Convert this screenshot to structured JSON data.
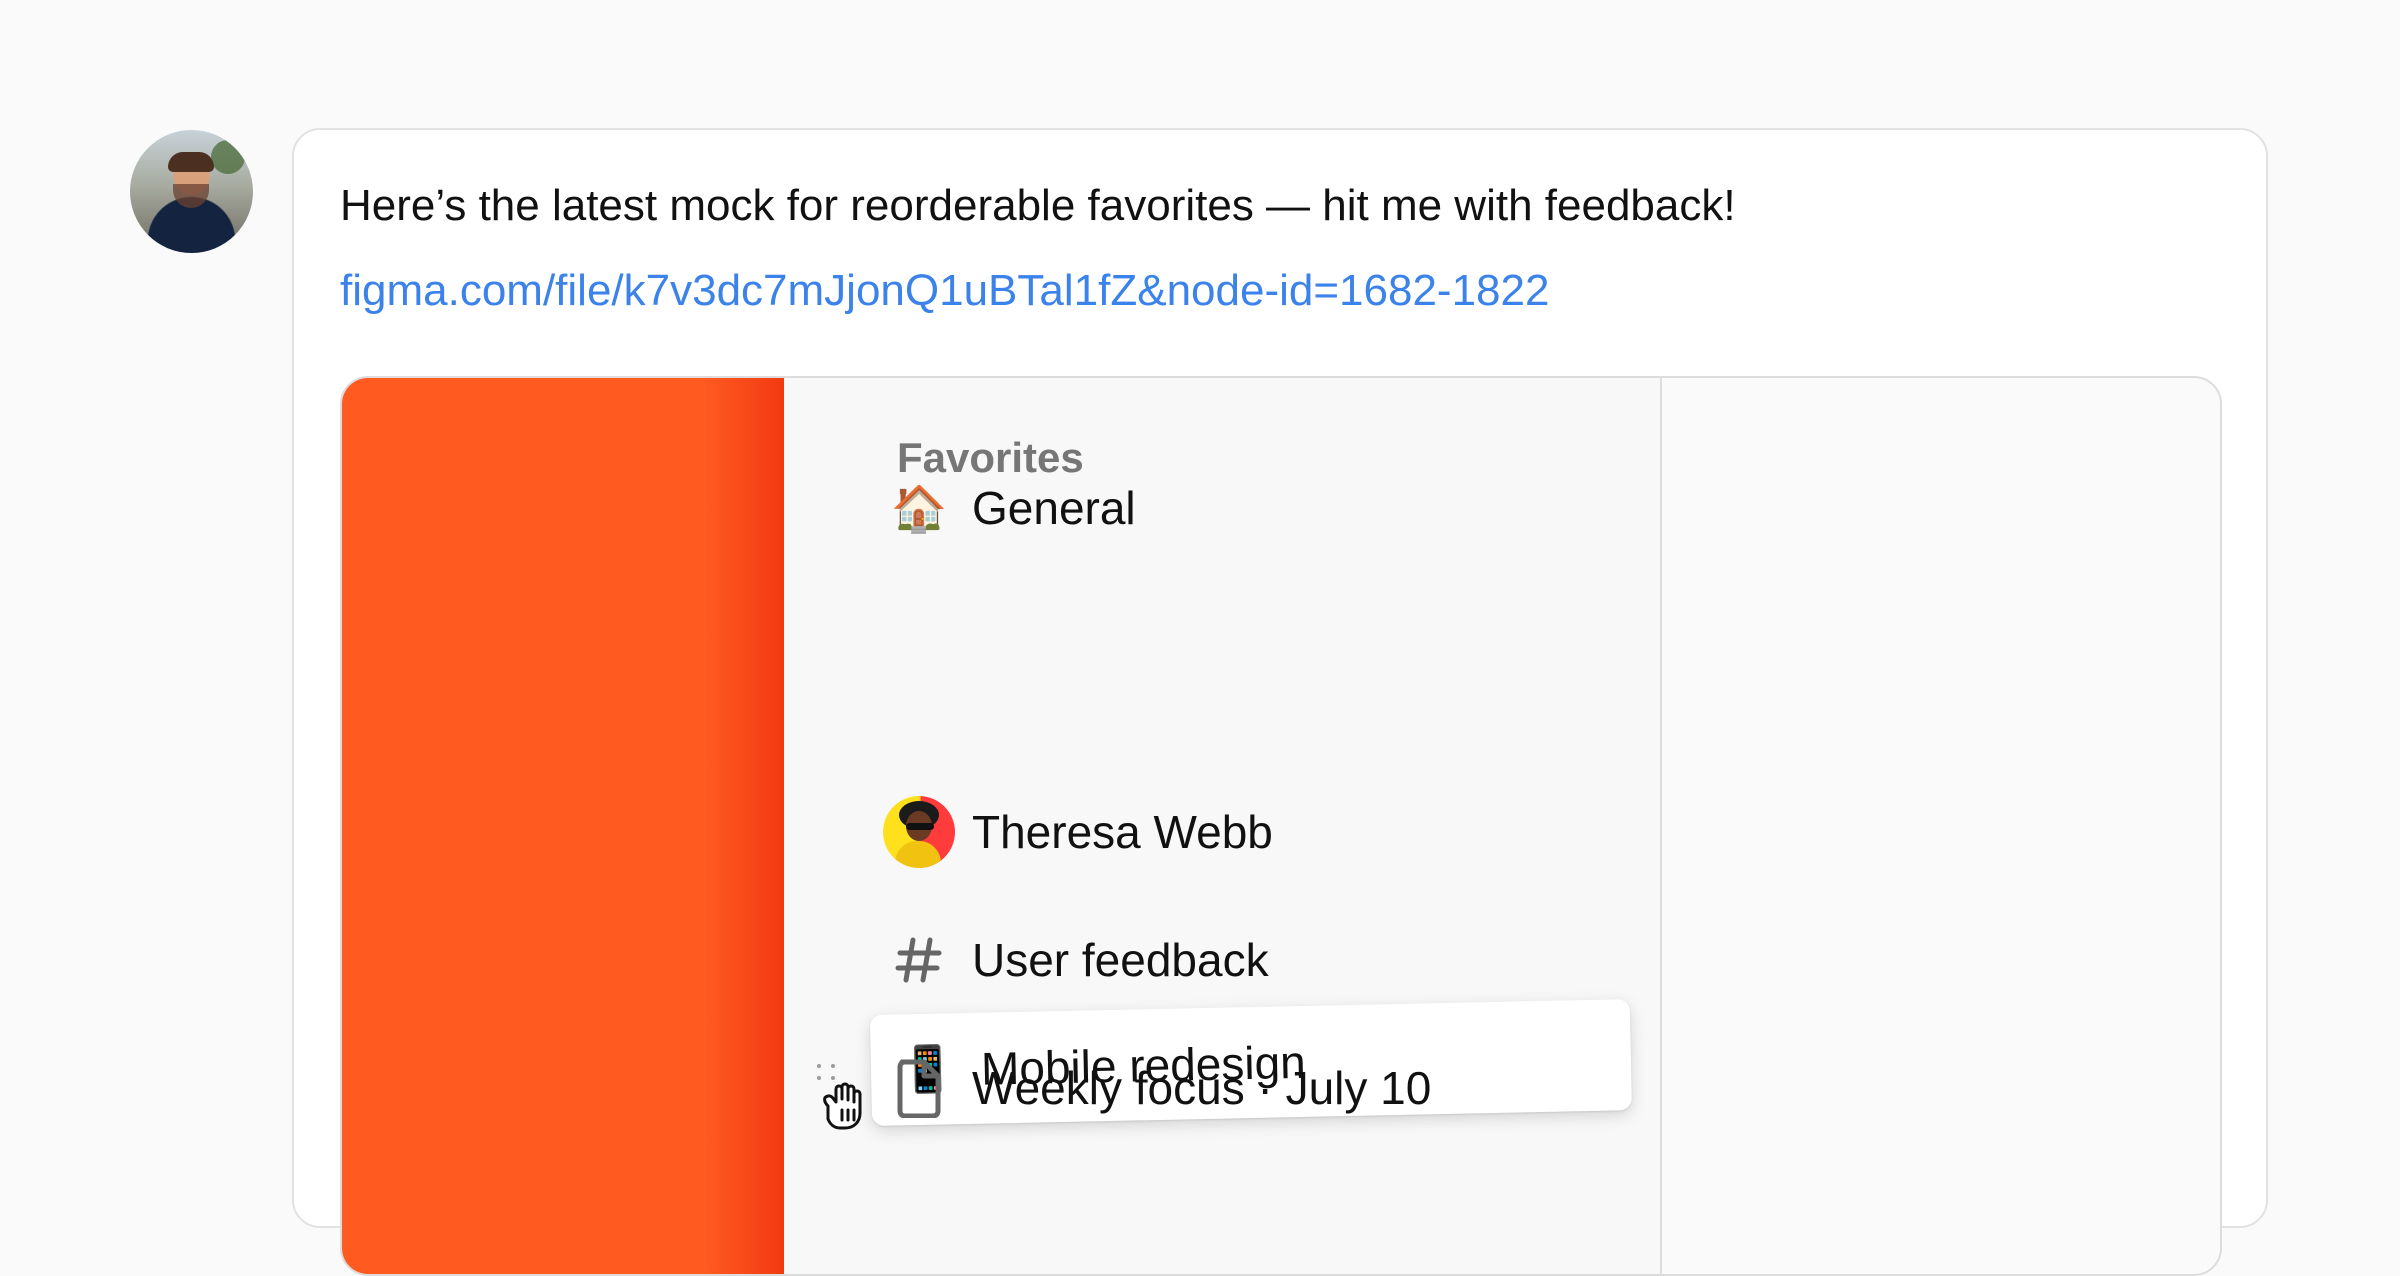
{
  "message": {
    "text": "Here’s the latest mock for reorderable favorites — hit me with feedback!",
    "link": "figma.com/file/k7v3dc7mJjonQ1uBTal1fZ&node-id=1682-1822"
  },
  "preview": {
    "sidebar_title": "Favorites",
    "items": [
      {
        "icon": "house-icon",
        "emoji": "🏠",
        "label": "General"
      },
      {
        "icon": "mobile-phone-icon",
        "emoji": "📱",
        "label": "Mobile redesign"
      },
      {
        "icon": "avatar-icon",
        "label": "Theresa Webb"
      },
      {
        "icon": "hash-icon",
        "emoji": "#",
        "label": "User feedback"
      },
      {
        "icon": "document-icon",
        "label": "Weekly focus · July 10"
      }
    ],
    "colors": {
      "brand": "#ff5a20",
      "link": "#3b82ea"
    }
  }
}
